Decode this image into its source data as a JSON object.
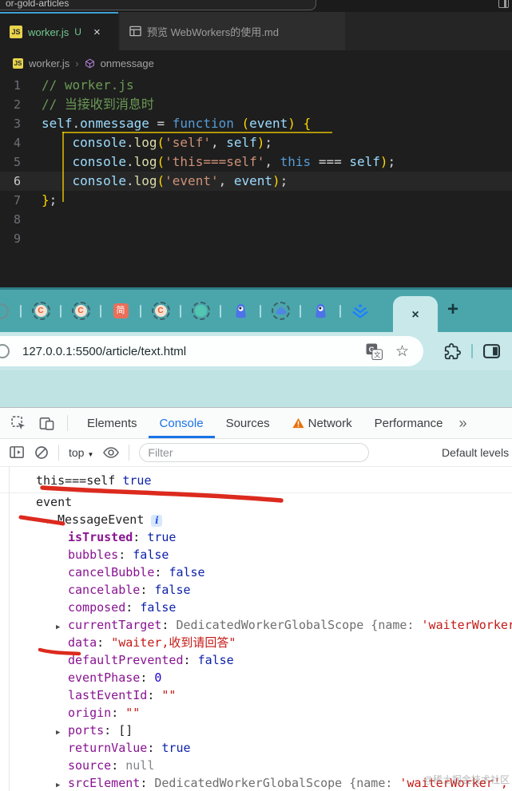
{
  "vscode": {
    "titlebar": {
      "search_text": "or-gold-articles"
    },
    "tabs": [
      {
        "label": "worker.js",
        "badge": "U",
        "close": "×",
        "active": true
      },
      {
        "label": "预览 WebWorkers的使用.md",
        "active": false
      }
    ],
    "breadcrumb": {
      "file": "worker.js",
      "separator": "›",
      "symbol": "onmessage"
    },
    "editor": {
      "lines": [
        {
          "num": "1",
          "segs": [
            {
              "c": "cm",
              "t": "// worker.js"
            }
          ]
        },
        {
          "num": "2",
          "segs": [
            {
              "c": "cm",
              "t": "// 当接收到消息时"
            }
          ]
        },
        {
          "num": "3",
          "segs": [
            {
              "c": "var",
              "t": "self"
            },
            {
              "c": "pl",
              "t": "."
            },
            {
              "c": "var",
              "t": "onmessage"
            },
            {
              "c": "pl",
              "t": " = "
            },
            {
              "c": "kw",
              "t": "function"
            },
            {
              "c": "pl",
              "t": " "
            },
            {
              "c": "br",
              "t": "("
            },
            {
              "c": "var",
              "t": "event"
            },
            {
              "c": "br",
              "t": ")"
            },
            {
              "c": "pl",
              "t": " "
            },
            {
              "c": "br",
              "t": "{"
            }
          ]
        },
        {
          "num": "4",
          "segs": [
            {
              "c": "pl",
              "t": "    "
            },
            {
              "c": "var",
              "t": "console"
            },
            {
              "c": "pl",
              "t": "."
            },
            {
              "c": "fn",
              "t": "log"
            },
            {
              "c": "br",
              "t": "("
            },
            {
              "c": "str",
              "t": "'self'"
            },
            {
              "c": "pl",
              "t": ", "
            },
            {
              "c": "var",
              "t": "self"
            },
            {
              "c": "br",
              "t": ")"
            },
            {
              "c": "pl",
              "t": ";"
            }
          ]
        },
        {
          "num": "5",
          "segs": [
            {
              "c": "pl",
              "t": "    "
            },
            {
              "c": "var",
              "t": "console"
            },
            {
              "c": "pl",
              "t": "."
            },
            {
              "c": "fn",
              "t": "log"
            },
            {
              "c": "br",
              "t": "("
            },
            {
              "c": "str",
              "t": "'this===self'"
            },
            {
              "c": "pl",
              "t": ", "
            },
            {
              "c": "kw",
              "t": "this"
            },
            {
              "c": "pl",
              "t": " === "
            },
            {
              "c": "var",
              "t": "self"
            },
            {
              "c": "br",
              "t": ")"
            },
            {
              "c": "pl",
              "t": ";"
            }
          ]
        },
        {
          "num": "6",
          "active": true,
          "segs": [
            {
              "c": "pl",
              "t": "    "
            },
            {
              "c": "var",
              "t": "console"
            },
            {
              "c": "pl",
              "t": "."
            },
            {
              "c": "fn",
              "t": "log"
            },
            {
              "c": "br",
              "t": "("
            },
            {
              "c": "str",
              "t": "'event'"
            },
            {
              "c": "pl",
              "t": ", "
            },
            {
              "c": "var",
              "t": "event"
            },
            {
              "c": "br",
              "t": ")"
            },
            {
              "c": "pl",
              "t": ";"
            }
          ]
        },
        {
          "num": "7",
          "segs": [
            {
              "c": "br",
              "t": "}"
            },
            {
              "c": "pl",
              "t": ";"
            }
          ]
        },
        {
          "num": "8",
          "segs": []
        },
        {
          "num": "9",
          "segs": []
        }
      ]
    }
  },
  "browser": {
    "pinned_tabs": [
      {
        "icon": "site-cut-icon"
      },
      {
        "icon": "csdn-icon"
      },
      {
        "icon": "csdn-icon"
      },
      {
        "icon": "jianshu-icon"
      },
      {
        "icon": "csdn-icon"
      },
      {
        "icon": "teal-dot-icon"
      },
      {
        "icon": "monster-icon"
      },
      {
        "icon": "cloud-icon"
      },
      {
        "icon": "monster-icon"
      },
      {
        "icon": "juejin-icon"
      }
    ],
    "active_tab_close": "×",
    "new_tab_label": "+",
    "url": "127.0.0.1:5500/article/text.html"
  },
  "devtools": {
    "tabs": [
      {
        "label": "Elements"
      },
      {
        "label": "Console",
        "active": true
      },
      {
        "label": "Sources"
      },
      {
        "label": "Network",
        "warning": true
      },
      {
        "label": "Performance"
      }
    ],
    "more_tabs": "»",
    "toolbar": {
      "context": "top",
      "filter_placeholder": "Filter",
      "levels": "Default levels"
    },
    "console": {
      "message1": {
        "segs": [
          {
            "c": "plain",
            "t": "this===self "
          },
          {
            "c": "bool",
            "t": "true"
          }
        ]
      },
      "rows": [
        {
          "ind": 0,
          "segs": [
            {
              "c": "plain",
              "t": "event"
            }
          ]
        },
        {
          "ind": 1,
          "arrow": "down",
          "segs": [
            {
              "c": "plain",
              "t": "MessageEvent"
            },
            {
              "c": "ibadge",
              "t": "i"
            }
          ]
        },
        {
          "ind": 2,
          "segs": [
            {
              "c": "propb",
              "t": "isTrusted"
            },
            {
              "c": "plain",
              "t": ": "
            },
            {
              "c": "bool",
              "t": "true"
            }
          ]
        },
        {
          "ind": 2,
          "segs": [
            {
              "c": "prop",
              "t": "bubbles"
            },
            {
              "c": "plain",
              "t": ": "
            },
            {
              "c": "bool",
              "t": "false"
            }
          ]
        },
        {
          "ind": 2,
          "segs": [
            {
              "c": "prop",
              "t": "cancelBubble"
            },
            {
              "c": "plain",
              "t": ": "
            },
            {
              "c": "bool",
              "t": "false"
            }
          ]
        },
        {
          "ind": 2,
          "segs": [
            {
              "c": "prop",
              "t": "cancelable"
            },
            {
              "c": "plain",
              "t": ": "
            },
            {
              "c": "bool",
              "t": "false"
            }
          ]
        },
        {
          "ind": 2,
          "segs": [
            {
              "c": "prop",
              "t": "composed"
            },
            {
              "c": "plain",
              "t": ": "
            },
            {
              "c": "bool",
              "t": "false"
            }
          ]
        },
        {
          "ind": 2,
          "arrow": "right",
          "segs": [
            {
              "c": "prop",
              "t": "currentTarget"
            },
            {
              "c": "plain",
              "t": ": "
            },
            {
              "c": "gray",
              "t": "DedicatedWorkerGlobalScope {name: "
            },
            {
              "c": "str",
              "t": "'waiterWorker"
            }
          ]
        },
        {
          "ind": 2,
          "segs": [
            {
              "c": "prop",
              "t": "data"
            },
            {
              "c": "plain",
              "t": ": "
            },
            {
              "c": "str",
              "t": "\"waiter,收到请回答\""
            }
          ]
        },
        {
          "ind": 2,
          "segs": [
            {
              "c": "prop",
              "t": "defaultPrevented"
            },
            {
              "c": "plain",
              "t": ": "
            },
            {
              "c": "bool",
              "t": "false"
            }
          ]
        },
        {
          "ind": 2,
          "segs": [
            {
              "c": "prop",
              "t": "eventPhase"
            },
            {
              "c": "plain",
              "t": ": "
            },
            {
              "c": "num",
              "t": "0"
            }
          ]
        },
        {
          "ind": 2,
          "segs": [
            {
              "c": "prop",
              "t": "lastEventId"
            },
            {
              "c": "plain",
              "t": ": "
            },
            {
              "c": "str",
              "t": "\"\""
            }
          ]
        },
        {
          "ind": 2,
          "segs": [
            {
              "c": "prop",
              "t": "origin"
            },
            {
              "c": "plain",
              "t": ": "
            },
            {
              "c": "str",
              "t": "\"\""
            }
          ]
        },
        {
          "ind": 2,
          "arrow": "right",
          "segs": [
            {
              "c": "prop",
              "t": "ports"
            },
            {
              "c": "plain",
              "t": ": "
            },
            {
              "c": "plain",
              "t": "[]"
            }
          ]
        },
        {
          "ind": 2,
          "segs": [
            {
              "c": "prop",
              "t": "returnValue"
            },
            {
              "c": "plain",
              "t": ": "
            },
            {
              "c": "bool",
              "t": "true"
            }
          ]
        },
        {
          "ind": 2,
          "segs": [
            {
              "c": "prop",
              "t": "source"
            },
            {
              "c": "plain",
              "t": ": "
            },
            {
              "c": "null",
              "t": "null"
            }
          ]
        },
        {
          "ind": 2,
          "arrow": "right",
          "segs": [
            {
              "c": "prop",
              "t": "srcElement"
            },
            {
              "c": "plain",
              "t": ": "
            },
            {
              "c": "gray",
              "t": "DedicatedWorkerGlobalScope {name: "
            },
            {
              "c": "str",
              "t": "'waiterWorker',"
            }
          ]
        }
      ]
    },
    "watermark": "@稀土掘金技术社区"
  },
  "colors": {
    "accent_blue": "#1a73e8",
    "teal_strip": "#4BA6AC",
    "annotation_red": "#DC2A1E",
    "editor_bg": "#1e1e1e"
  }
}
